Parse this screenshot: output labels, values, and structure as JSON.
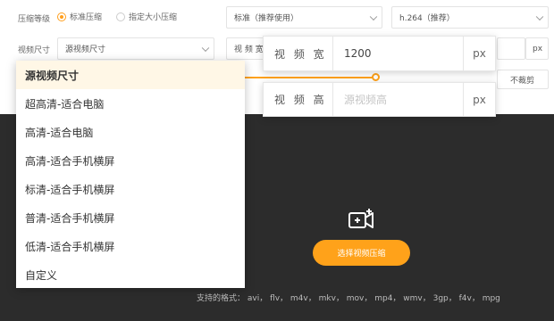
{
  "compress": {
    "label": "压缩等级",
    "radio_standard": "标准压缩",
    "radio_size": "指定大小压缩",
    "quality_select": "标准（推荐使用）",
    "codec_select": "h.264（推荐）"
  },
  "size": {
    "label": "视频尺寸",
    "select_value": "源视频尺寸",
    "hidden_w_label": "视 频 宽",
    "px_unit": "px"
  },
  "crop_button": "不裁剪",
  "width_popup": {
    "label": "视 频 宽",
    "value": "1200",
    "unit": "px"
  },
  "height_popup": {
    "label": "视 频 高",
    "placeholder": "源视频高",
    "unit": "px"
  },
  "dropdown": {
    "items": [
      "源视频尺寸",
      "超高清-适合电脑",
      "高清-适合电脑",
      "高清-适合手机横屏",
      "标清-适合手机横屏",
      "普清-适合手机横屏",
      "低清-适合手机横屏",
      "自定义"
    ]
  },
  "upload": {
    "icon": "add-video-icon",
    "button": "选择视频压缩",
    "formats": "支持的格式：  avi，  flv，  m4v，  mkv，  mov，  mp4，  wmv，  3gp，  f4v，  mpg"
  },
  "colors": {
    "accent": "#ffa21a",
    "dark": "#2c2c2c"
  }
}
